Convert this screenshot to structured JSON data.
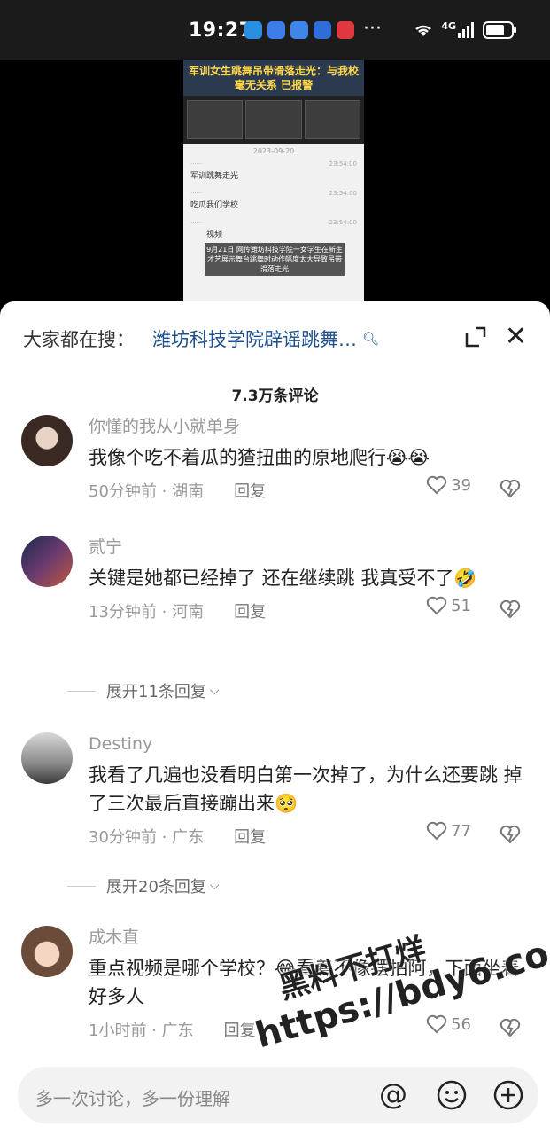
{
  "status_bar": {
    "time": "19:27",
    "more": "···",
    "network": "4G",
    "app_icon_colors": [
      "#2a8fe0",
      "#3d7de8",
      "#3f86e9",
      "#2f6ed8",
      "#e0383e"
    ]
  },
  "video": {
    "headline": "军训女生跳舞吊带滑落走光：与我校毫无关系 已报警",
    "chat_date": "2023-09-20",
    "chat_messages": [
      {
        "text": "军训跳舞走光",
        "time": "23:54:00"
      },
      {
        "text": "吃瓜我们学校",
        "time": "23:54:00"
      },
      {
        "text": "视频",
        "time": "23:54:00"
      }
    ],
    "caption": "9月21日 网传潍坊科技学院一女学生在新生才艺展示舞台跳舞时动作幅度太大导致吊带滑落走光"
  },
  "search": {
    "prefix": "大家都在搜：",
    "query": "潍坊科技学院辟谣跳舞…",
    "query_color": "#1f4f8c"
  },
  "comment_count": "7.3万条评论",
  "comments": [
    {
      "user": "你懂的我从小就单身",
      "text": "我像个吃不着瓜的猹扭曲的原地爬行😭😭",
      "meta": "50分钟前 · 湖南",
      "reply": "回复",
      "likes": "39"
    },
    {
      "user": "贰宁",
      "text": "关键是她都已经掉了 还在继续跳 我真受不了🤣",
      "meta": "13分钟前 · 河南",
      "reply": "回复",
      "likes": "51",
      "expand": "展开11条回复"
    },
    {
      "user": "Destiny",
      "text": "我看了几遍也没看明白第一次掉了，为什么还要跳 掉了三次最后直接蹦出来🥺",
      "meta": "30分钟前 · 广东",
      "reply": "回复",
      "likes": "77",
      "expand": "展开20条回复"
    },
    {
      "user": "成木直",
      "text": "重点视频是哪个学校？😂看着不像摆拍阿，下面坐着好多人",
      "meta": "1小时前 · 广东",
      "reply": "回复",
      "likes": "56"
    }
  ],
  "input": {
    "placeholder": "多一次讨论，多一份理解"
  },
  "watermark": {
    "line1": "黑料不打烊",
    "line2": "https://bdy6.co"
  }
}
